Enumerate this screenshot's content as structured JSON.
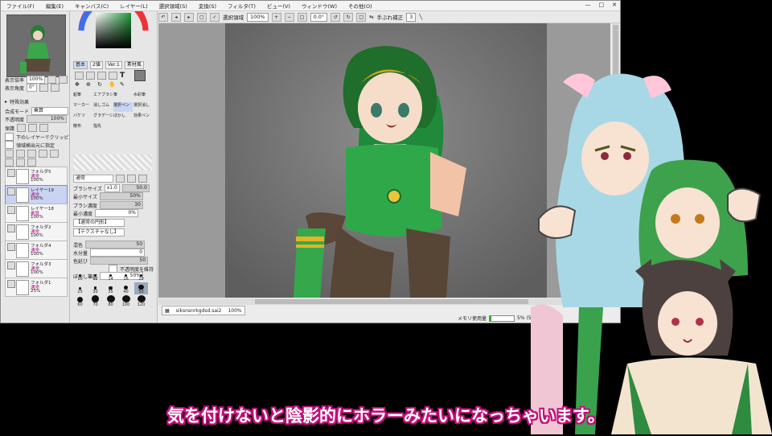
{
  "menu": [
    "ファイル(F)",
    "編集(E)",
    "キャンバス(C)",
    "レイヤー(L)",
    "選択領域(S)",
    "変換(S)",
    "フィルタ(T)",
    "ビュー(V)",
    "ウィンドウ(W)",
    "その他(O)"
  ],
  "window_controls": [
    "—",
    "□",
    "✕"
  ],
  "toolbar": {
    "select_label": "選択領域",
    "zoom": "100%",
    "angle": "0.0°",
    "stabilizer_label": "手ぶれ補正",
    "stabilizer_value": "3"
  },
  "navigator": {
    "zoom_label": "表示倍率",
    "zoom_value": "100%",
    "angle_label": "表示角度",
    "angle_value": "0°"
  },
  "effects": {
    "title": "特殊効果",
    "blend_label": "合成モード",
    "blend_value": "乗算",
    "opacity_label": "不透明度",
    "opacity_value": "100%",
    "protect_label": "保護",
    "clip_label": "下のレイヤーでクリッピング",
    "select_source_label": "領域検出元に指定"
  },
  "layers": [
    {
      "name": "フォルダ5",
      "mode": "通常",
      "opacity": "100%",
      "selected": false
    },
    {
      "name": "レイヤー19",
      "mode": "通常",
      "opacity": "100%",
      "selected": true
    },
    {
      "name": "レイヤー18",
      "mode": "乗算",
      "opacity": "100%",
      "selected": false
    },
    {
      "name": "フォルダ2",
      "mode": "通常",
      "opacity": "100%",
      "selected": false
    },
    {
      "name": "フォルダ4",
      "mode": "通常",
      "opacity": "100%",
      "selected": false
    },
    {
      "name": "フォルダ3",
      "mode": "通常",
      "opacity": "100%",
      "selected": false
    },
    {
      "name": "フォルダ1",
      "mode": "通常",
      "opacity": "25%",
      "selected": false
    }
  ],
  "color_tabs": [
    "基本",
    "2値",
    "Ver.1",
    "素材風"
  ],
  "tool_labels": [
    "鉛筆",
    "エアブラシ",
    "筆",
    "水彩筆",
    "マーカー",
    "消しゴム",
    "選択ペン",
    "選択消し",
    "バケツ",
    "グラデーション",
    "ぼかし",
    "効果ペン",
    "散布",
    "指先"
  ],
  "brush": {
    "mode": "通常",
    "size_label": "ブラシサイズ",
    "size_mult": "x1.0",
    "size_value": "50.0",
    "min_size_label": "最小サイズ",
    "min_size_value": "50%",
    "density_label": "ブラシ濃度",
    "density_value": "30",
    "min_density_label": "最小濃度",
    "min_density_value": "0%",
    "shape_label": "【通常の円形】",
    "texture_label": "【テクスチャなし】",
    "mix_label": "混色",
    "mix_value": "50",
    "water_label": "水分量",
    "water_value": "0",
    "stretch_label": "色延び",
    "stretch_value": "50",
    "keep_opacity_label": "不透明度を維持",
    "blur_label": "ぼかし筆圧",
    "blur_value": "50%"
  },
  "brush_sizes": [
    "10",
    "12",
    "14",
    "16",
    "20",
    "25",
    "30",
    "35",
    "40",
    "50",
    "60",
    "70",
    "80",
    "100",
    "120"
  ],
  "file_tab": {
    "name": "siksnsnrkgdsd.sai2",
    "zoom": "100%"
  },
  "status": {
    "memory_label": "メモリ使用量",
    "memory_value": "5% (5%)",
    "memory_fraction": 0.05
  },
  "subtitle": "気を付けないと陰影的にホラーみたいになっちゃいます。",
  "colors": {
    "accent": "#c0117a",
    "layer_selected": "#c9d3f2",
    "blend_pink": "#b0178b"
  }
}
